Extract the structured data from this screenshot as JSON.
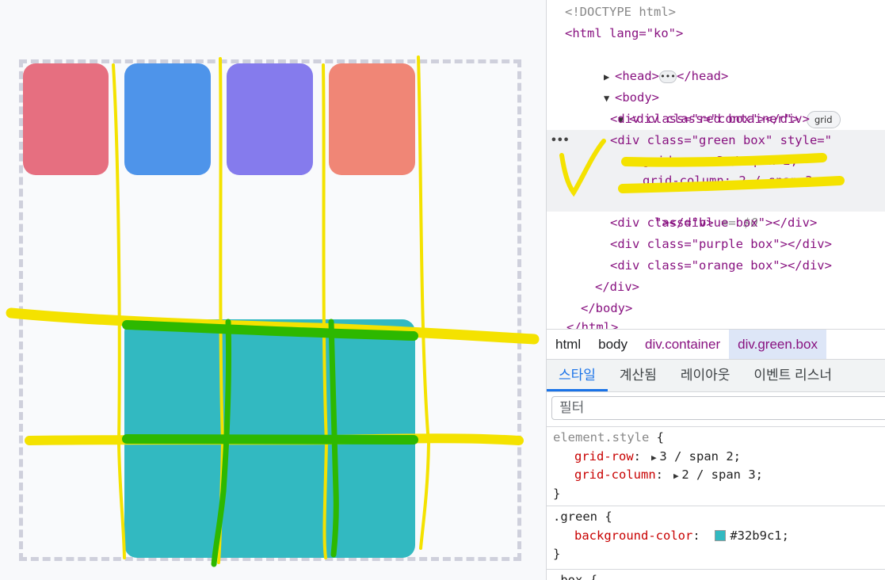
{
  "preview": {
    "boxes": {
      "red": "#e66f80",
      "blue": "#4e94ea",
      "purple": "#857bed",
      "orange": "#f08676",
      "green": "#32b9c1"
    }
  },
  "dom_tree": {
    "doctype": "<!DOCTYPE html>",
    "html_open": "<html lang=\"ko\">",
    "head_open": "<head>",
    "head_close": "</head>",
    "body_open": "<body>",
    "container_open": "<div class=\"container\">",
    "grid_badge": "grid",
    "red_box": "<div class=\"red box\"></div>",
    "green_open": "<div class=\"green box\" style=\"",
    "green_style_1": "grid-row: 3 / span 2;",
    "green_style_2": "grid-column: 2 / span 3;",
    "green_close": "\"></div>",
    "green_marker": "== $0",
    "blue_box": "<div class=\"blue box\"></div>",
    "purple_box": "<div class=\"purple box\"></div>",
    "orange_box": "<div class=\"orange box\"></div>",
    "div_close": "</div>",
    "body_close": "</body>",
    "html_close": "</html>"
  },
  "breadcrumb": [
    "html",
    "body",
    "div.container",
    "div.green.box"
  ],
  "tabs": [
    "스타일",
    "계산됨",
    "레이아웃",
    "이벤트 리스너"
  ],
  "filter_placeholder": "필터",
  "styles": {
    "element_style": {
      "selector": "element.style",
      "props": [
        {
          "name": "grid-row",
          "value": "3 / span 2;"
        },
        {
          "name": "grid-column",
          "value": "2 / span 3;"
        }
      ]
    },
    "green_rule": {
      "selector": ".green",
      "prop_name": "background-color",
      "prop_value": "#32b9c1;",
      "swatch": "#32b9c1"
    },
    "box_rule": {
      "selector": ".box {"
    }
  }
}
